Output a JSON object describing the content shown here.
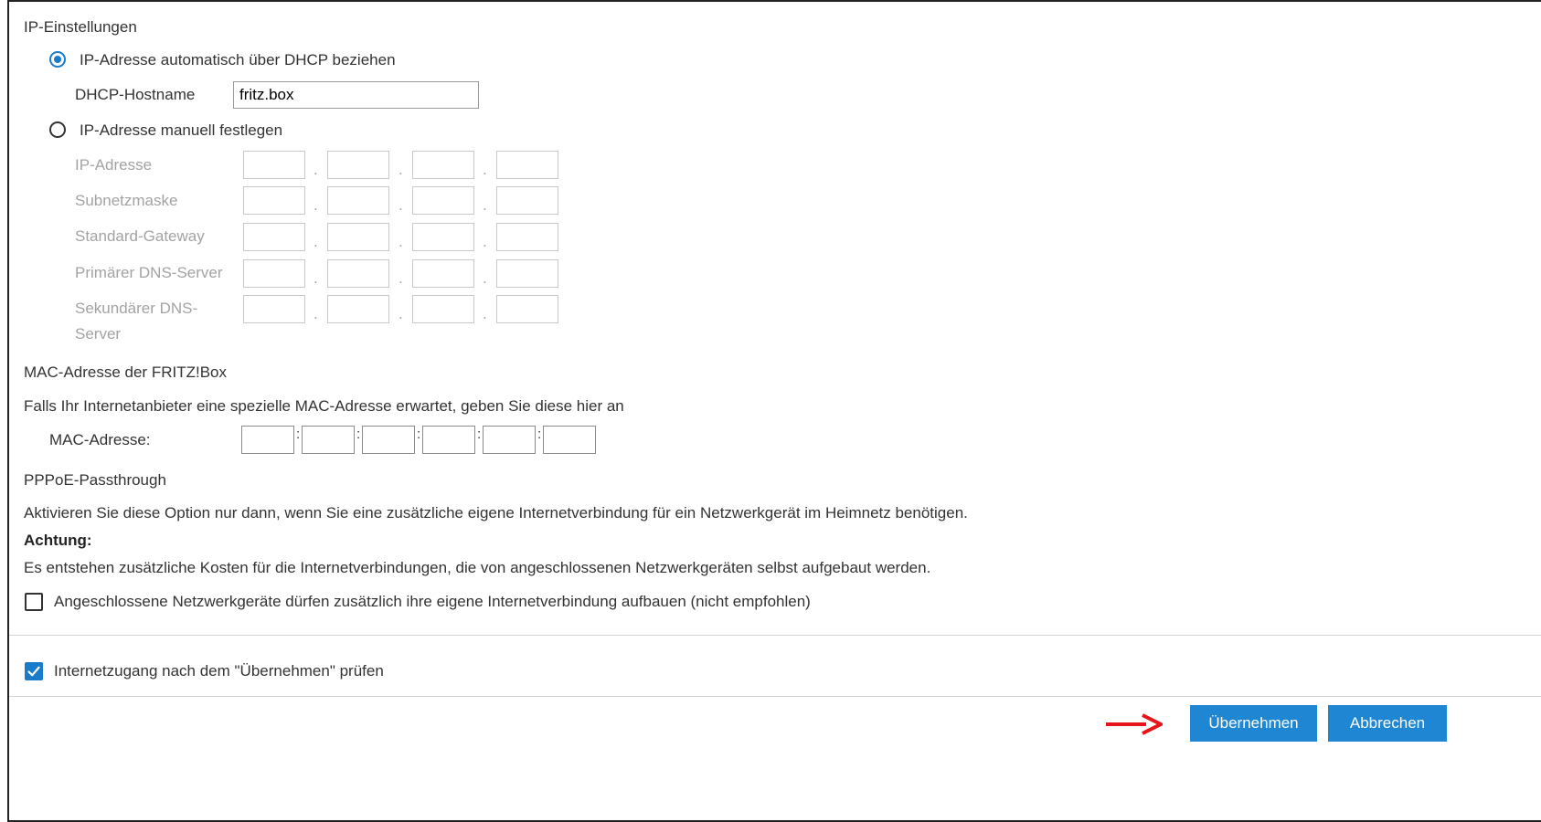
{
  "ip_settings": {
    "heading": "IP-Einstellungen",
    "dhcp_option_label": "IP-Adresse automatisch über DHCP beziehen",
    "dhcp_selected": true,
    "hostname_label": "DHCP-Hostname",
    "hostname_value": "fritz.box",
    "manual_option_label": "IP-Adresse manuell festlegen",
    "manual_selected": false,
    "rows": [
      {
        "label": "IP-Adresse"
      },
      {
        "label": "Subnetzmaske"
      },
      {
        "label": "Standard-Gateway"
      },
      {
        "label": "Primärer DNS-Server"
      },
      {
        "label_line1": "Sekundärer DNS-",
        "label_line2": "Server"
      }
    ],
    "separator": "."
  },
  "mac": {
    "heading": "MAC-Adresse der FRITZ!Box",
    "description": "Falls Ihr Internetanbieter eine spezielle MAC-Adresse erwartet, geben Sie diese hier an",
    "label": "MAC-Adresse:",
    "separator": ":"
  },
  "pppoe": {
    "heading": "PPPoE-Passthrough",
    "description": "Aktivieren Sie diese Option nur dann, wenn Sie eine zusätzliche eigene Internetverbindung für ein Netzwerkgerät im Heimnetz benötigen.",
    "warning_title": "Achtung:",
    "warning_text": "Es entstehen zusätzliche Kosten für die Internetverbindungen, die von angeschlossenen Netzwerkgeräten selbst aufgebaut werden.",
    "checkbox_label": "Angeschlossene Netzwerkgeräte dürfen zusätzlich ihre eigene Internetverbindung aufbauen (nicht empfohlen)",
    "checkbox_checked": false
  },
  "check_internet": {
    "label": "Internetzugang nach dem \"Übernehmen\" prüfen",
    "checked": true
  },
  "buttons": {
    "apply": "Übernehmen",
    "cancel": "Abbrechen"
  },
  "colors": {
    "accent": "#1f86d3",
    "arrow": "#e8141b",
    "disabled_text": "#a3a3a3"
  }
}
